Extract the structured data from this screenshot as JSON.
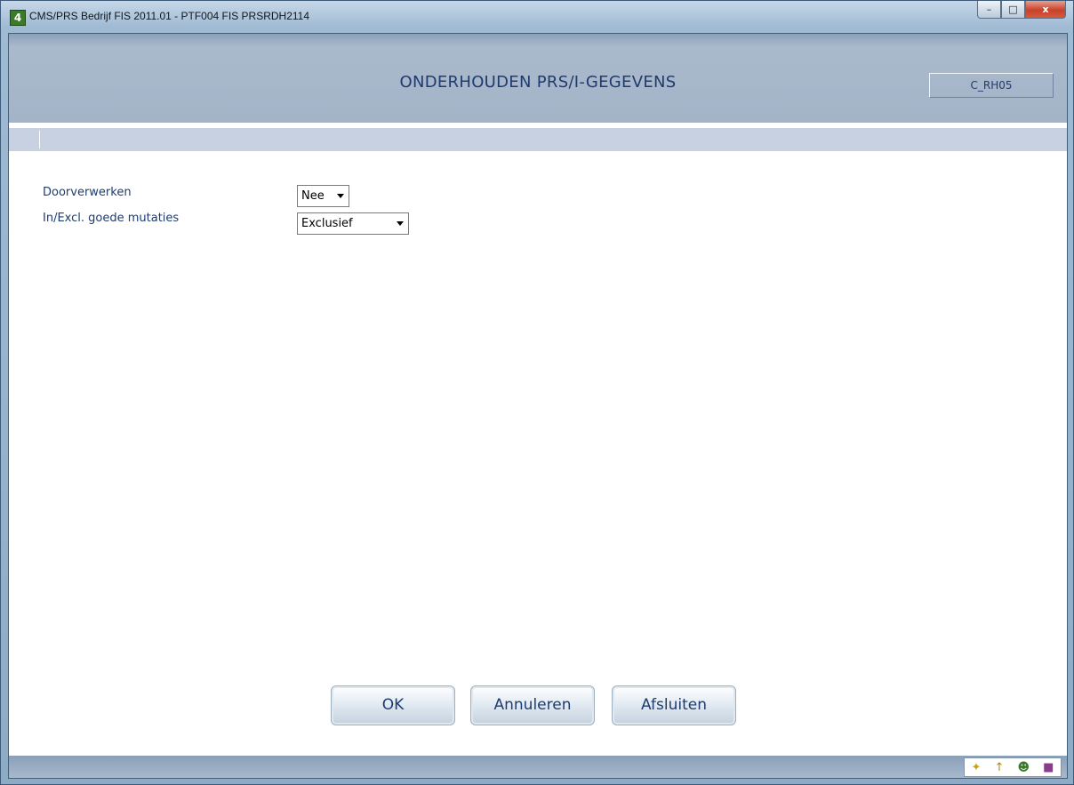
{
  "window": {
    "title": "CMS/PRS  Bedrijf FIS 2011.01  - PTF004 FIS PRSRDH2114",
    "app_icon_label": "4"
  },
  "window_controls": {
    "minimize": "–",
    "maximize": "□",
    "close": "x"
  },
  "header": {
    "title": "ONDERHOUDEN PRS/I-GEGEVENS",
    "screen_code": "C_RH05"
  },
  "form": {
    "fields": [
      {
        "label": "Doorverwerken",
        "value": "Nee"
      },
      {
        "label": "In/Excl. goede mutaties",
        "value": "Exclusief"
      }
    ]
  },
  "buttons": {
    "ok": "OK",
    "cancel": "Annuleren",
    "close": "Afsluiten"
  },
  "status_icons": [
    "tools-icon",
    "pin-icon",
    "user-icon",
    "box-icon"
  ],
  "colors": {
    "header_text": "#1f3c6e",
    "header_bg": "#a4b4c8"
  }
}
